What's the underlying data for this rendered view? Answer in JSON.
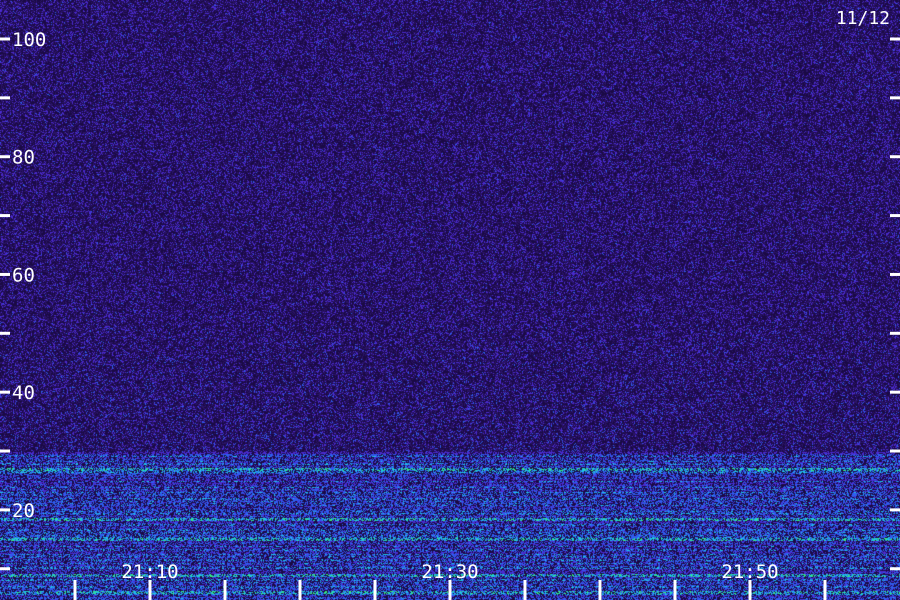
{
  "page": {
    "date_label": "11/12"
  },
  "chart_data": {
    "type": "heatmap",
    "title": "",
    "xlabel": "",
    "ylabel": "",
    "y_ticks_labeled": [
      20,
      40,
      60,
      80,
      100
    ],
    "y_ticks_minor": [
      10,
      30,
      50,
      70,
      90
    ],
    "ylim": [
      0,
      102
    ],
    "x_ticks_labeled": [
      "21:10",
      "21:30",
      "21:50"
    ],
    "x_minor_ticks_minutes": [
      5,
      10,
      15,
      20,
      25,
      30,
      35,
      40,
      45,
      50,
      55
    ],
    "xlim_minutes": [
      0,
      60
    ],
    "grid": false,
    "legend": "none",
    "colors": {
      "background": "#1a0a45",
      "noise_low": "#2a1468",
      "noise_high": "#4a2bd0",
      "mid": "#2f5df0",
      "high": "#1fc6e8",
      "peak": "#36f07a"
    },
    "intense_bands_value_ranges": [
      [
        0,
        30
      ]
    ],
    "bright_lines_values": [
      27,
      18.5,
      15,
      9,
      6
    ]
  }
}
